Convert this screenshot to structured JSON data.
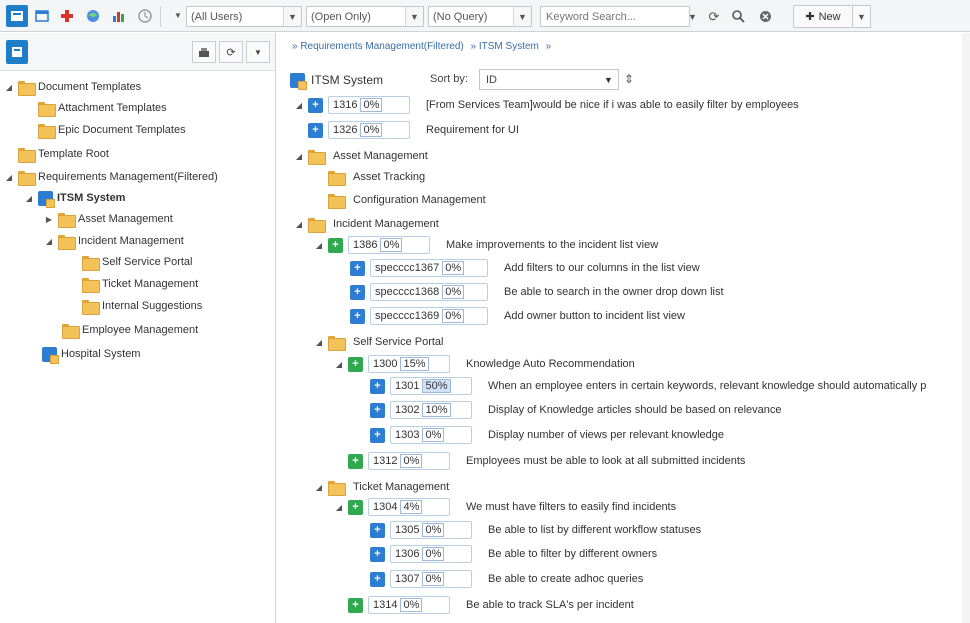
{
  "toolbar": {
    "filter_users": "(All Users)",
    "filter_open": "(Open Only)",
    "filter_query": "(No Query)",
    "search_placeholder": "Keyword Search...",
    "new_label": "New",
    "icons": [
      "home-icon",
      "window-icon",
      "plus-red-icon",
      "globe-icon",
      "chart-icon",
      "clock-icon"
    ]
  },
  "left_tree": {
    "items": [
      {
        "label": "Document Templates"
      },
      {
        "label": "Attachment Templates"
      },
      {
        "label": "Epic Document Templates"
      },
      {
        "label": "Template Root"
      },
      {
        "label": "Requirements Management(Filtered)"
      },
      {
        "label": "ITSM System"
      },
      {
        "label": "Asset Management"
      },
      {
        "label": "Incident Management"
      },
      {
        "label": "Self Service Portal"
      },
      {
        "label": "Ticket Management"
      },
      {
        "label": "Internal Suggestions"
      },
      {
        "label": "Employee Management"
      },
      {
        "label": "Hospital System"
      }
    ]
  },
  "breadcrumb": [
    "» Requirements Management(Filtered)",
    "» ITSM System",
    "»"
  ],
  "project": {
    "title": "ITSM System",
    "sort_label": "Sort by:",
    "sort_value": "ID"
  },
  "rows": [
    {
      "id": "1316",
      "pct": "0%",
      "text": "[From Services Team]would be nice if i was able to easily filter by employees"
    },
    {
      "id": "1326",
      "pct": "0%",
      "text": "Requirement for UI"
    },
    {
      "folder": "Asset Management"
    },
    {
      "folder": "Asset Tracking"
    },
    {
      "folder": "Configuration Management"
    },
    {
      "folder": "Incident Management"
    },
    {
      "id": "1386",
      "pct": "0%",
      "text": "Make improvements to the incident list view"
    },
    {
      "id": "specccc1367",
      "pct": "0%",
      "text": "Add filters to our columns in the list view"
    },
    {
      "id": "specccc1368",
      "pct": "0%",
      "text": "Be able to search in the owner drop down list"
    },
    {
      "id": "specccc1369",
      "pct": "0%",
      "text": "Add owner button to incident list view"
    },
    {
      "folder": "Self Service Portal"
    },
    {
      "id": "1300",
      "pct": "15%",
      "text": "Knowledge Auto Recommendation"
    },
    {
      "id": "1301",
      "pct": "50%",
      "text": "When an employee enters in certain keywords, relevant knowledge should automatically p"
    },
    {
      "id": "1302",
      "pct": "10%",
      "text": "Display of Knowledge articles should be based on relevance"
    },
    {
      "id": "1303",
      "pct": "0%",
      "text": "Display number of views per relevant knowledge"
    },
    {
      "id": "1312",
      "pct": "0%",
      "text": "Employees must be able to look at all submitted incidents"
    },
    {
      "folder": "Ticket Management"
    },
    {
      "id": "1304",
      "pct": "4%",
      "text": "We must have filters to easily find incidents"
    },
    {
      "id": "1305",
      "pct": "0%",
      "text": "Be able to list by different workflow statuses"
    },
    {
      "id": "1306",
      "pct": "0%",
      "text": "Be able to filter by different owners"
    },
    {
      "id": "1307",
      "pct": "0%",
      "text": "Be able to create adhoc queries"
    },
    {
      "id": "1314",
      "pct": "0%",
      "text": "Be able to track SLA's per incident"
    }
  ]
}
